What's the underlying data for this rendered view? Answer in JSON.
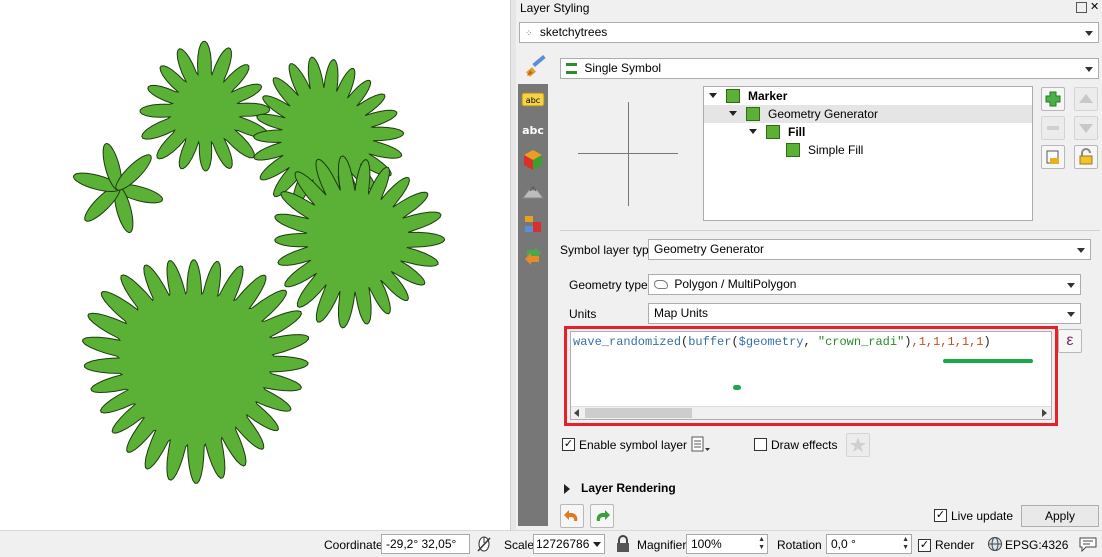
{
  "panel": {
    "title": "Layer Styling",
    "layer_name": "sketchytrees",
    "renderer": "Single Symbol"
  },
  "symbol_tree": {
    "items": [
      {
        "label": "Marker",
        "bold": true
      },
      {
        "label": "Geometry Generator",
        "bold": false
      },
      {
        "label": "Fill",
        "bold": true
      },
      {
        "label": "Simple Fill",
        "bold": false
      }
    ]
  },
  "symbol_layer": {
    "type_label": "Symbol layer type",
    "type_value": "Geometry Generator",
    "geometry_type_label": "Geometry type",
    "geometry_type_value": "Polygon / MultiPolygon",
    "units_label": "Units",
    "units_value": "Map Units",
    "expression": {
      "func1": "wave_randomized",
      "p1": "(",
      "func2": "buffer",
      "p2": "(",
      "geom": "$geometry",
      "comma1": ", ",
      "str": "\"crown_radi\"",
      "p3": ")",
      "nums": ",1,1,1,1,1",
      "p4": ")"
    },
    "epsilon_symbol": "ε",
    "enable_label": "Enable symbol layer",
    "enable_checked": true,
    "draw_effects_label": "Draw effects",
    "draw_effects_checked": false
  },
  "layer_rendering": {
    "label": "Layer Rendering"
  },
  "footer": {
    "live_update_label": "Live update",
    "live_update_checked": true,
    "apply_label": "Apply"
  },
  "status": {
    "coordinate_label": "Coordinate",
    "coordinate_value": "-29,2°  32,05°",
    "scale_label": "Scale",
    "scale_value": "12726786",
    "magnifier_label": "Magnifier",
    "magnifier_value": "100%",
    "rotation_label": "Rotation",
    "rotation_value": "0,0 °",
    "render_label": "Render",
    "render_checked": true,
    "crs_label": "EPSG:4326"
  },
  "colors": {
    "tree_fill": "#5ab135",
    "highlight_border": "#e8202a",
    "underline": "#1aa84a"
  }
}
